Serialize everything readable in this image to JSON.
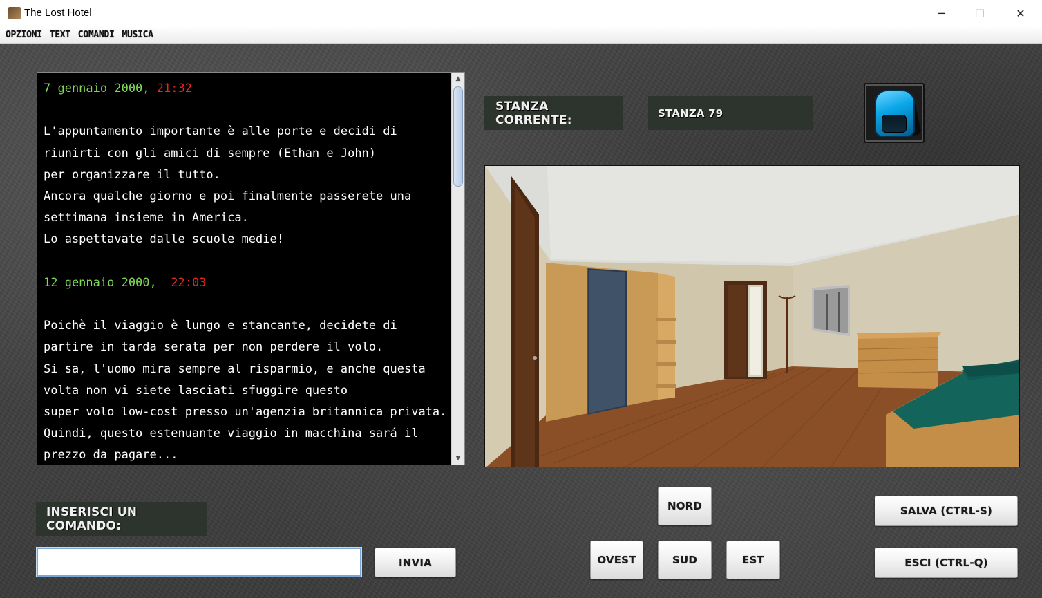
{
  "window": {
    "title": "The Lost Hotel",
    "minimize_glyph": "─",
    "maximize_glyph": "☐",
    "close_glyph": "✕"
  },
  "menu": [
    "OPZIONI",
    "TEXT",
    "COMANDI",
    "MUSICA"
  ],
  "story": {
    "entry1_date": "7 gennaio 2000, ",
    "entry1_time": "21:32",
    "entry1_lines": [
      "L'appuntamento importante è alle porte e decidi di",
      "riunirti con gli amici di sempre (Ethan e John)",
      "per organizzare il tutto.",
      "Ancora qualche giorno e poi finalmente passerete una",
      "settimana insieme in America.",
      "Lo aspettavate dalle scuole medie!"
    ],
    "entry2_date": "12 gennaio 2000,  ",
    "entry2_time": "22:03",
    "entry2_lines": [
      "Poichè il viaggio è lungo e stancante, decidete di",
      "partire in tarda serata per non perdere il volo.",
      "Si sa, l'uomo mira sempre al risparmio, e anche questa",
      "volta non vi siete lasciati sfuggire questo",
      "super volo low-cost presso un'agenzia britannica privata.",
      "Quindi, questo estenuante viaggio in macchina sará il",
      "prezzo da pagare..."
    ]
  },
  "room": {
    "label": "STANZA CORRENTE:",
    "value": "STANZA 79"
  },
  "command": {
    "label": "INSERISCI UN COMANDO:",
    "value": "",
    "send": "INVIA"
  },
  "directions": {
    "north": "NORD",
    "west": "OVEST",
    "south": "SUD",
    "east": "EST"
  },
  "actions": {
    "save": "SALVA (CTRL-S)",
    "quit": "ESCI (CTRL-Q)"
  },
  "icons": {
    "inventory": "backpack-icon",
    "app": "hotel-icon"
  },
  "colors": {
    "date": "#7ed957",
    "time": "#e8281f",
    "label_bg": "#2d332d"
  }
}
